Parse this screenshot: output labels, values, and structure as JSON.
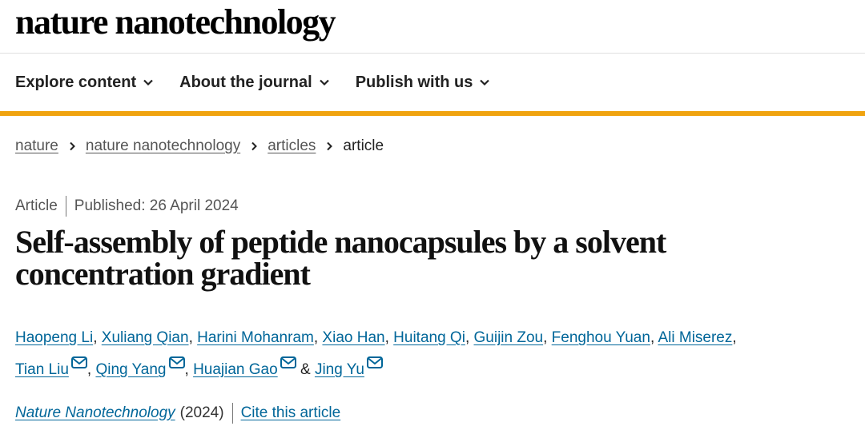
{
  "site": {
    "logo": "nature nanotechnology",
    "accent_color": "#f0a30f",
    "link_color": "#006699"
  },
  "nav": {
    "items": [
      {
        "label": "Explore content",
        "icon": "chevron-down-icon"
      },
      {
        "label": "About the journal",
        "icon": "chevron-down-icon"
      },
      {
        "label": "Publish with us",
        "icon": "chevron-down-icon"
      }
    ]
  },
  "breadcrumb": {
    "links": [
      "nature",
      "nature nanotechnology",
      "articles"
    ],
    "current": "article",
    "separator_icon": "chevron-right-icon"
  },
  "article": {
    "type": "Article",
    "published": "Published: 26 April 2024",
    "title": "Self-assembly of peptide nanocapsules by a solvent concentration gradient",
    "authors_line1": [
      "Haopeng Li",
      "Xuliang Qian",
      "Harini Mohanram",
      "Xiao Han",
      "Huitang Qi",
      "Guijin Zou",
      "Fenghou Yuan",
      "Ali Miserez"
    ],
    "authors_line2": [
      "Tian Liu",
      "Qing Yang",
      "Huajian Gao",
      "Jing Yu"
    ],
    "separator": ",",
    "ampersand": "&",
    "mail_icon": "envelope-icon",
    "journal": "Nature Nanotechnology",
    "year": "(2024)",
    "cite_label": "Cite this article"
  }
}
